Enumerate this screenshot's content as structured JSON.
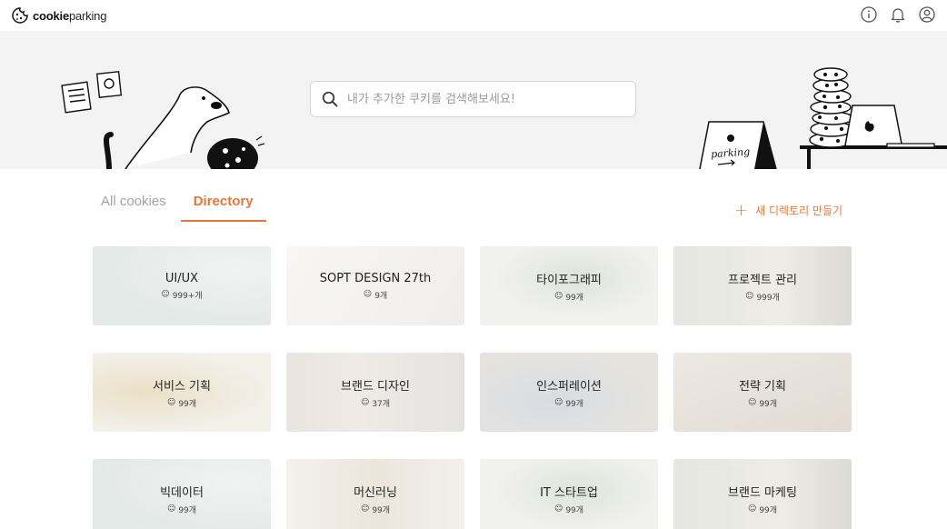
{
  "brand": {
    "logo_bold": "cookie",
    "logo_rest": "parking"
  },
  "header_icons": [
    "info-icon",
    "bell-icon",
    "user-icon"
  ],
  "search": {
    "placeholder": "내가 추가한 쿠키를 검색해보세요!"
  },
  "banner": {
    "sign_text": "parking"
  },
  "tabs": [
    {
      "label": "All cookies",
      "active": false
    },
    {
      "label": "Directory",
      "active": true
    }
  ],
  "new_directory_label": "새 디렉토리 만들기",
  "accent_color": "#e8753a",
  "directories": [
    {
      "title": "UI/UX",
      "count": "999+개"
    },
    {
      "title": "SOPT DESIGN 27th",
      "count": "9개"
    },
    {
      "title": "타이포그래피",
      "count": "99개"
    },
    {
      "title": "프로젝트 관리",
      "count": "999개"
    },
    {
      "title": "서비스 기획",
      "count": "99개"
    },
    {
      "title": "브랜드 디자인",
      "count": "37개"
    },
    {
      "title": "인스퍼레이션",
      "count": "99개"
    },
    {
      "title": "전략 기획",
      "count": "99개"
    },
    {
      "title": "빅데이터",
      "count": "99개"
    },
    {
      "title": "머신러닝",
      "count": "99개"
    },
    {
      "title": "IT 스타트업",
      "count": "99개"
    },
    {
      "title": "브랜드 마케팅",
      "count": "99개"
    }
  ]
}
